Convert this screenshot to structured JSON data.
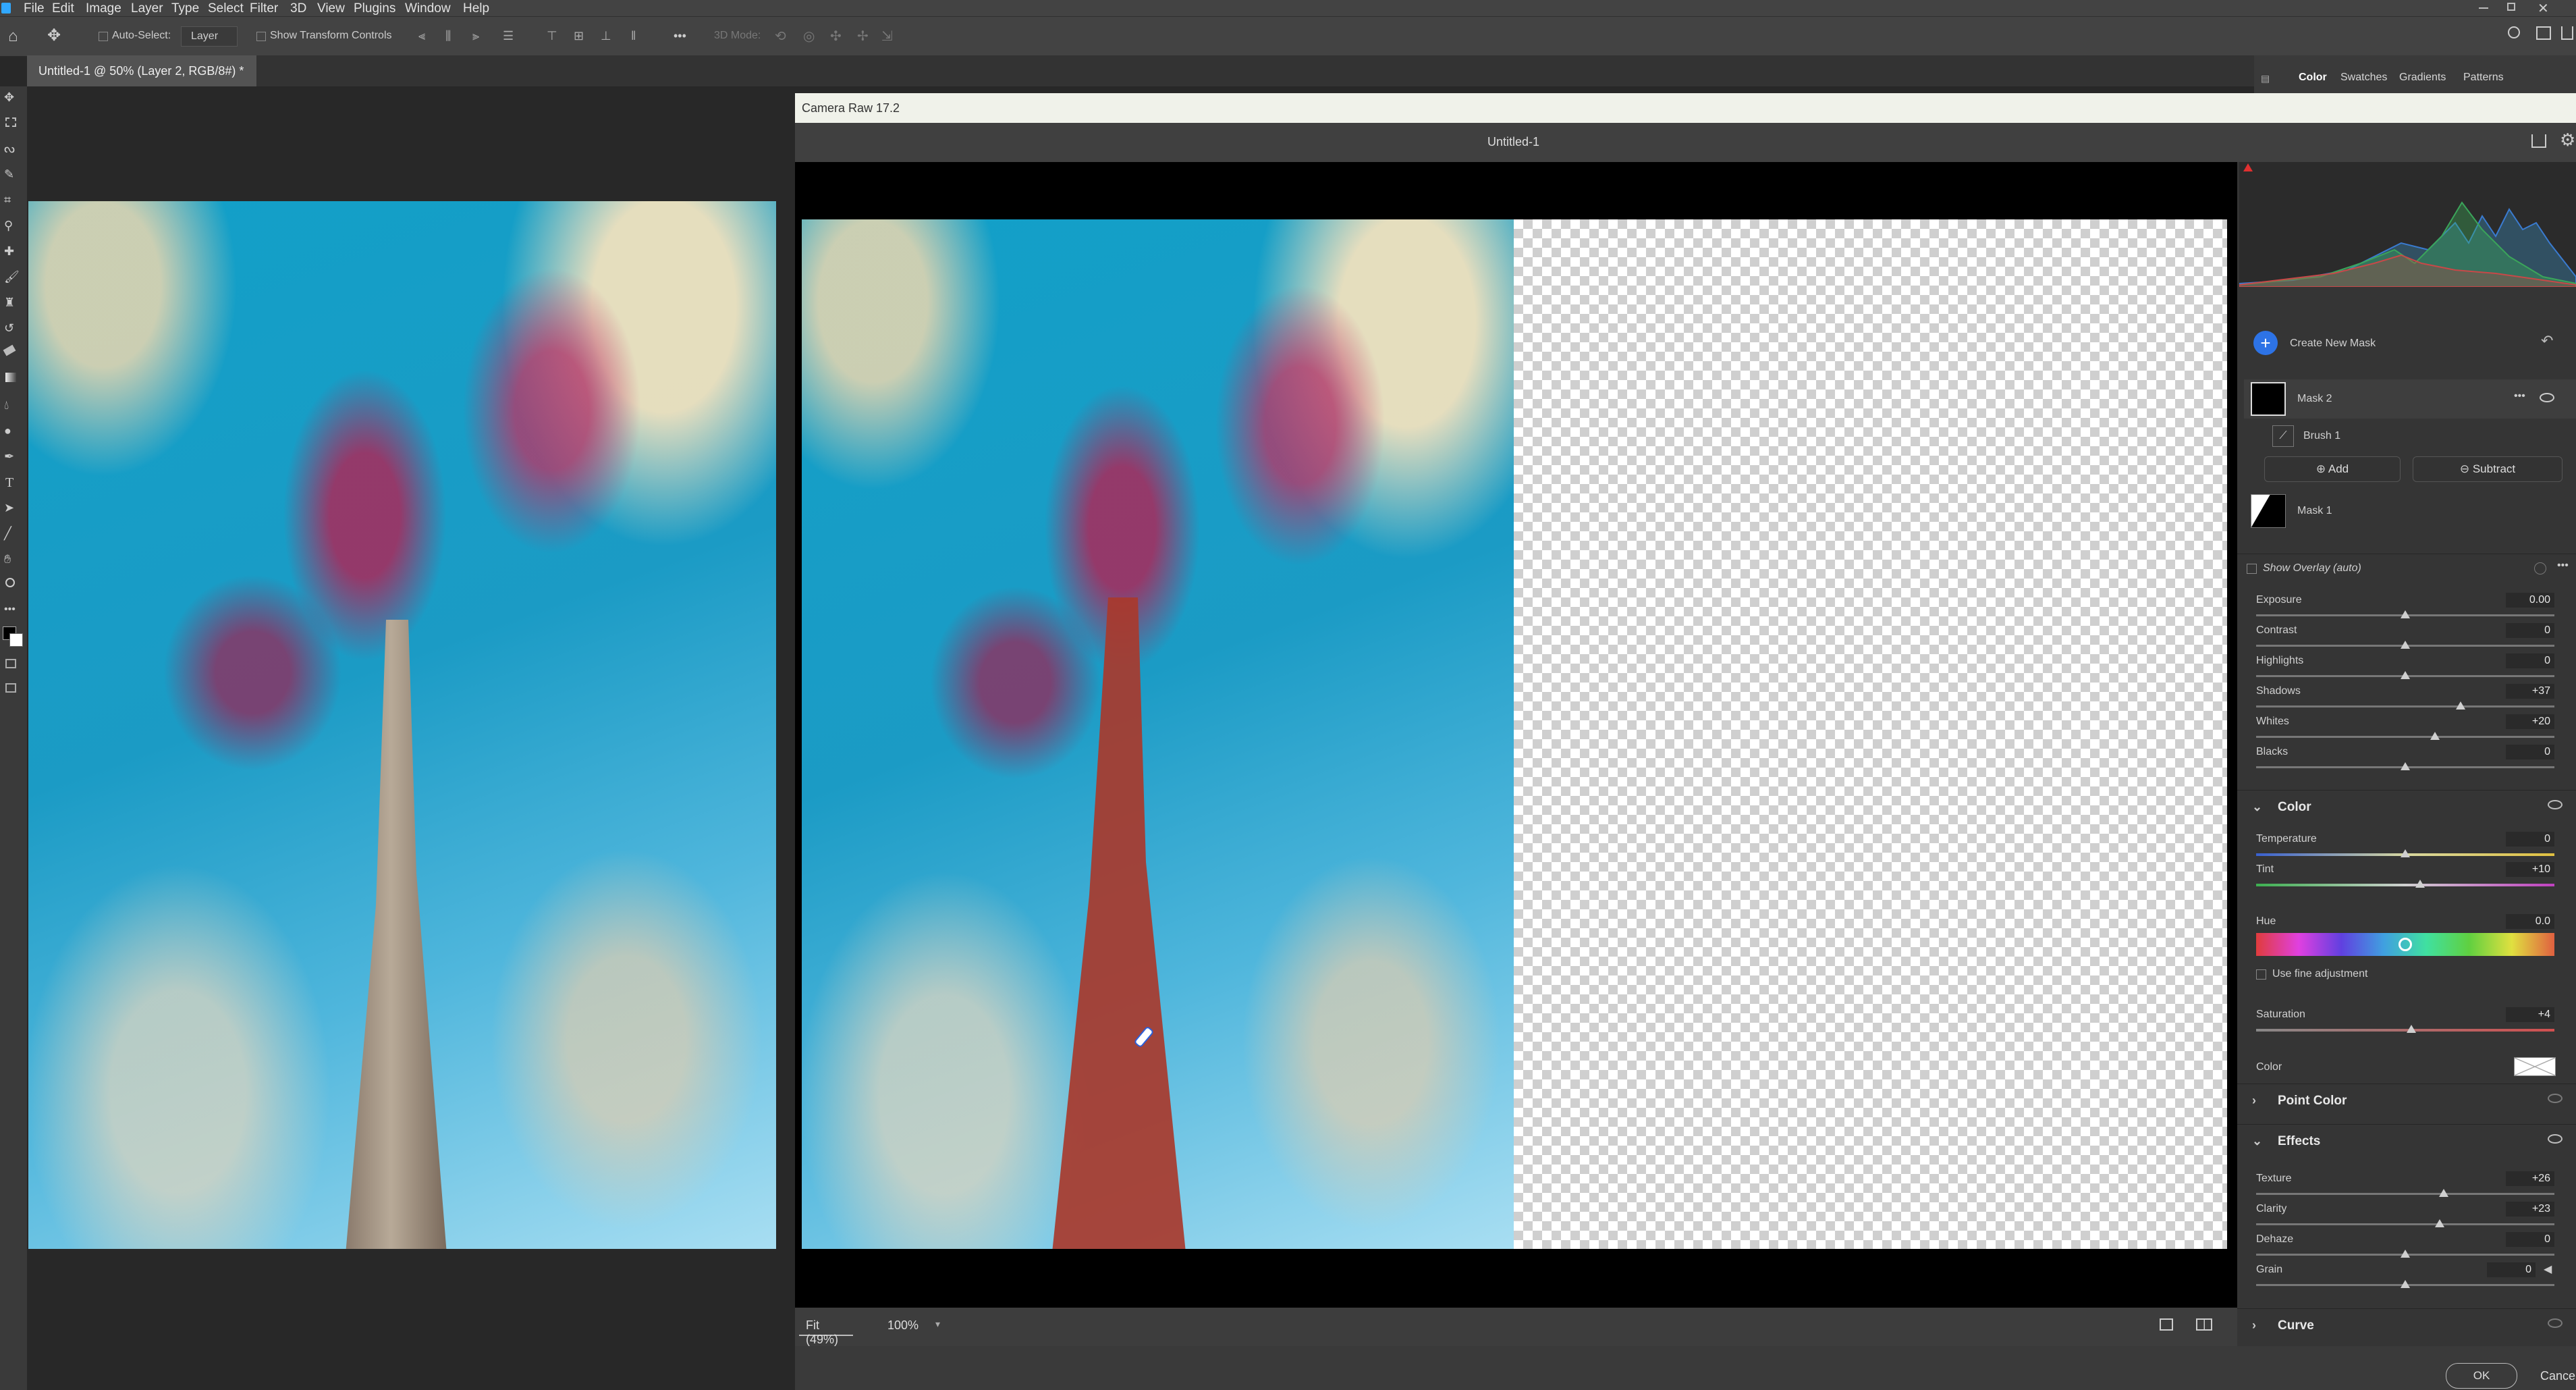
{
  "menubar": {
    "items": [
      "File",
      "Edit",
      "Image",
      "Layer",
      "Type",
      "Select",
      "Filter",
      "3D",
      "View",
      "Plugins",
      "Window",
      "Help"
    ]
  },
  "options": {
    "auto_select_label": "Auto-Select:",
    "auto_select_target": "Layer",
    "transform_controls_label": "Show Transform Controls",
    "mode_3d_label": "3D Mode:",
    "more_label": "•••"
  },
  "document": {
    "tab_title": "Untitled-1 @ 50% (Layer 2, RGB/8#) *",
    "close_glyph": "×"
  },
  "right_panel_tabs": [
    "Color",
    "Swatches",
    "Gradients",
    "Patterns"
  ],
  "camera_raw": {
    "title": "Camera Raw 17.2",
    "doc_name": "Untitled-1",
    "zoom_fit": "Fit (49%)",
    "zoom_100": "100%",
    "ok_label": "OK",
    "cancel_label": "Cancel"
  },
  "masks": {
    "create_label": "Create New Mask",
    "mask2": "Mask 2",
    "brush1": "Brush 1",
    "add": "Add",
    "subtract": "Subtract",
    "mask1": "Mask 1",
    "show_overlay": "Show Overlay (auto)"
  },
  "light": [
    {
      "label": "Exposure",
      "value": "0.00",
      "pos": 0.5
    },
    {
      "label": "Contrast",
      "value": "0",
      "pos": 0.5
    },
    {
      "label": "Highlights",
      "value": "0",
      "pos": 0.5
    },
    {
      "label": "Shadows",
      "value": "+37",
      "pos": 0.685
    },
    {
      "label": "Whites",
      "value": "+20",
      "pos": 0.6
    },
    {
      "label": "Blacks",
      "value": "0",
      "pos": 0.5
    }
  ],
  "color": {
    "section": "Color",
    "temperature": {
      "label": "Temperature",
      "value": "0",
      "pos": 0.5
    },
    "tint": {
      "label": "Tint",
      "value": "+10",
      "pos": 0.55
    },
    "hue": {
      "label": "Hue",
      "value": "0.0",
      "pos": 0.5
    },
    "fine": "Use fine adjustment",
    "saturation": {
      "label": "Saturation",
      "value": "+4",
      "pos": 0.52
    },
    "color_label": "Color"
  },
  "point_color": "Point Color",
  "effects": {
    "section": "Effects",
    "items": [
      {
        "label": "Texture",
        "value": "+26",
        "pos": 0.63
      },
      {
        "label": "Clarity",
        "value": "+23",
        "pos": 0.615
      },
      {
        "label": "Dehaze",
        "value": "0",
        "pos": 0.5
      },
      {
        "label": "Grain",
        "value": "0",
        "pos": 0.5
      }
    ]
  },
  "curve": "Curve"
}
